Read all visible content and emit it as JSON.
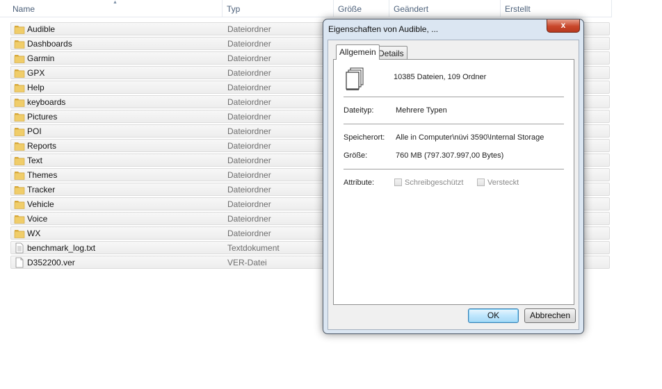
{
  "explorer": {
    "columns": [
      "Name",
      "Typ",
      "Größe",
      "Geändert",
      "Erstellt"
    ],
    "rows": [
      {
        "name": "Audible",
        "type": "Dateiordner",
        "icon": "folder-icon"
      },
      {
        "name": "Dashboards",
        "type": "Dateiordner",
        "icon": "folder-icon"
      },
      {
        "name": "Garmin",
        "type": "Dateiordner",
        "icon": "folder-icon"
      },
      {
        "name": "GPX",
        "type": "Dateiordner",
        "icon": "folder-icon"
      },
      {
        "name": "Help",
        "type": "Dateiordner",
        "icon": "folder-icon"
      },
      {
        "name": "keyboards",
        "type": "Dateiordner",
        "icon": "folder-icon"
      },
      {
        "name": "Pictures",
        "type": "Dateiordner",
        "icon": "folder-icon"
      },
      {
        "name": "POI",
        "type": "Dateiordner",
        "icon": "folder-icon"
      },
      {
        "name": "Reports",
        "type": "Dateiordner",
        "icon": "folder-icon"
      },
      {
        "name": "Text",
        "type": "Dateiordner",
        "icon": "folder-icon"
      },
      {
        "name": "Themes",
        "type": "Dateiordner",
        "icon": "folder-icon"
      },
      {
        "name": "Tracker",
        "type": "Dateiordner",
        "icon": "folder-icon"
      },
      {
        "name": "Vehicle",
        "type": "Dateiordner",
        "icon": "folder-icon"
      },
      {
        "name": "Voice",
        "type": "Dateiordner",
        "icon": "folder-icon"
      },
      {
        "name": "WX",
        "type": "Dateiordner",
        "icon": "folder-icon"
      },
      {
        "name": "benchmark_log.txt",
        "type": "Textdokument",
        "icon": "text-file-icon"
      },
      {
        "name": "D352200.ver",
        "type": "VER-Datei",
        "icon": "file-icon"
      }
    ]
  },
  "dialog": {
    "title": "Eigenschaften von Audible, ...",
    "close_label": "x",
    "tabs": [
      "Allgemein",
      "Details"
    ],
    "summary": "10385 Dateien, 109 Ordner",
    "filetype_label": "Dateityp:",
    "filetype_value": "Mehrere Typen",
    "location_label": "Speicherort:",
    "location_value": "Alle in Computer\\nüvi 3590\\Internal Storage",
    "size_label": "Größe:",
    "size_value": "760 MB (797.307.997,00 Bytes)",
    "attributes_label": "Attribute:",
    "readonly_label": "Schreibgeschützt",
    "hidden_label": "Versteckt",
    "ok_label": "OK",
    "cancel_label": "Abbrechen"
  },
  "colors": {
    "folder": "#e8c257",
    "dialog_frame": "#dbe6f2",
    "close_button": "#c8462a"
  }
}
